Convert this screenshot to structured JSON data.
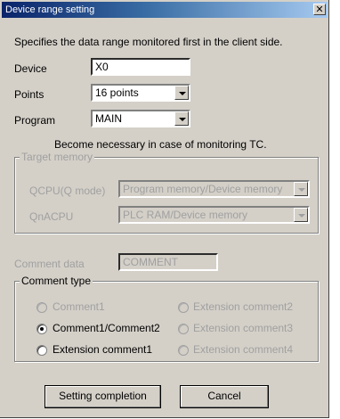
{
  "window": {
    "title": "Device range setting",
    "close_glyph": "✕"
  },
  "intro_text": "Specifies the data range monitored first in the client side.",
  "device": {
    "label": "Device",
    "value": "X0"
  },
  "points": {
    "label": "Points",
    "value": "16 points"
  },
  "program": {
    "label": "Program",
    "value": "MAIN"
  },
  "tc_note": "Become necessary in case of monitoring TC.",
  "target_memory": {
    "title": "Target memory",
    "qcpu": {
      "label": "QCPU(Q mode)",
      "value": "Program memory/Device memory"
    },
    "qnacpu": {
      "label": "QnACPU",
      "value": "PLC RAM/Device memory"
    }
  },
  "comment_data": {
    "label": "Comment data",
    "value": "COMMENT"
  },
  "comment_type": {
    "title": "Comment type",
    "options": {
      "comment1": {
        "label": "Comment1",
        "enabled": false,
        "selected": false
      },
      "comment1_comment2": {
        "label": "Comment1/Comment2",
        "enabled": true,
        "selected": true
      },
      "extension_comment1": {
        "label": "Extension comment1",
        "enabled": true,
        "selected": false
      },
      "extension_comment": {
        "label": "Extension comment2",
        "enabled": false,
        "selected": false
      },
      "extension_comment3": {
        "label": "Extension comment3",
        "enabled": false,
        "selected": false
      },
      "extension_comment4": {
        "label": "Extension comment4",
        "enabled": false,
        "selected": false
      }
    }
  },
  "buttons": {
    "setting_completion": "Setting completion",
    "cancel": "Cancel"
  },
  "colors": {
    "titlebar_start": "#0a246a",
    "titlebar_end": "#a6caf0",
    "dialog_bg": "#d4d0c8",
    "disabled_text": "#a0a0a0"
  }
}
